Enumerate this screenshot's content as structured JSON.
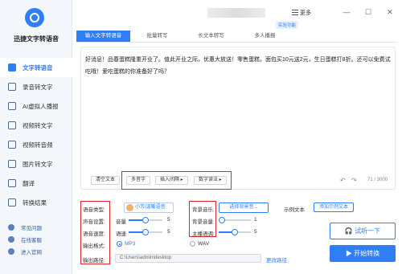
{
  "app": {
    "name": "迅捷文字转语音"
  },
  "sidebar": {
    "items": [
      {
        "label": "文字转语音",
        "active": true,
        "icon": "text-to-speech-icon"
      },
      {
        "label": "录音转文字",
        "icon": "recording-icon"
      },
      {
        "label": "AI虚拟人播报",
        "icon": "ai-avatar-icon"
      },
      {
        "label": "视频转文字",
        "icon": "video-text-icon"
      },
      {
        "label": "视频转音频",
        "icon": "video-audio-icon"
      },
      {
        "label": "图片转文字",
        "icon": "image-text-icon"
      },
      {
        "label": "翻译",
        "icon": "translate-icon"
      },
      {
        "label": "转换结果",
        "icon": "result-icon"
      }
    ],
    "links": [
      {
        "label": "常见问题",
        "icon": "help-icon"
      },
      {
        "label": "在线客服",
        "icon": "support-icon"
      },
      {
        "label": "进入官网",
        "icon": "website-icon"
      }
    ]
  },
  "header": {
    "chip": "实验功能",
    "more": "更多",
    "minimize": "—",
    "maximize": "☐",
    "close": "✕"
  },
  "tabs": [
    "输入文字转语音",
    "批量转写",
    "长文本转写",
    "多人播报"
  ],
  "editor": {
    "text": "好消息！品春蛋糕隆重开业了。值此开业之际，优惠大放送！零售蛋糕，面包买10元送2元，生日蛋糕打8折。还可以免费试吃哦！爱吃蛋糕的你准备好了吗？",
    "buttons": {
      "clear": "清空文本",
      "polyphone": "多音字",
      "insert_pause": "插入间隔 ▸",
      "number_reading": "数字读法 ▸"
    },
    "counter": "71 / 3000"
  },
  "settings": {
    "voice_type_label": "语音类型:",
    "voice_name": "小芳/温暖语音",
    "volume_label": "声音设置:",
    "volume_sub": "音量",
    "volume_value": "5",
    "speed_label": "语音速度:",
    "speed_sub": "语速",
    "speed_value": "5",
    "format_label": "输出格式:",
    "format_mp3": "MP3",
    "format_wav": "WAV",
    "path_label": "输出路径:",
    "path_value": "C:\\Users\\admin\\desktop",
    "change_path": "更改路径",
    "bgm_label": "背景音乐:",
    "bgm_button": "选择背景音...",
    "bgm_volume_label": "背景音量:",
    "bgm_volume_value": "1",
    "main_volume_label": "主播语调:",
    "main_volume_value": "5",
    "sample_label": "示例文本",
    "add_sample": "添加示例文本",
    "listen": "试听一下",
    "convert": "开始转换"
  },
  "levels": {
    "volume": 0.5,
    "speed": 0.5,
    "bgm_volume": 0.1,
    "main_volume": 0.5
  },
  "colors": {
    "accent": "#2f7ef5",
    "highlight": "#e0262a",
    "sidebar": "#f3f6fb"
  }
}
